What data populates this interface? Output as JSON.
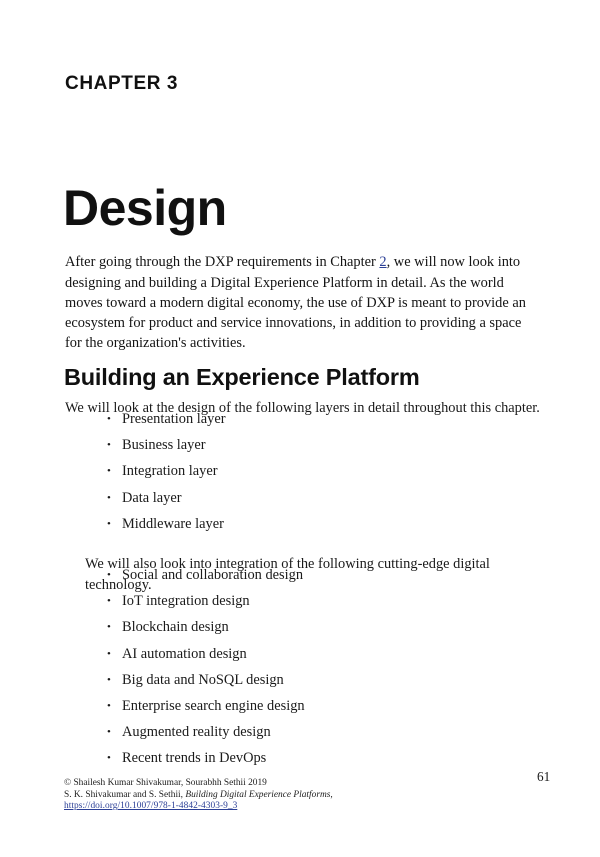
{
  "chapter": {
    "eyebrow": "CHAPTER 3",
    "title": "Design"
  },
  "intro": {
    "before_link": "After going through the DXP requirements in Chapter ",
    "link_text": "2",
    "after_link": ", we will now look into designing and building a Digital Experience Platform in detail. As the world moves toward a modern digital economy, the use of DXP is meant to provide an ecosystem for product and service innovations, in addition to providing a space for the organization's activities."
  },
  "section": {
    "heading": "Building an Experience Platform",
    "lead_in_layers": "We will look at the design of the following layers in detail throughout this chapter.",
    "lead_in_tech": "We will also look into integration of the following cutting-edge digital technology."
  },
  "bullet_glyph": "•",
  "layers_list": [
    {
      "label": "Presentation layer"
    },
    {
      "label": "Business layer"
    },
    {
      "label": "Integration layer"
    },
    {
      "label": "Data layer"
    },
    {
      "label": "Middleware layer"
    }
  ],
  "tech_list": [
    {
      "label": "Social and collaboration design"
    },
    {
      "label": "IoT integration design"
    },
    {
      "label": "Blockchain design"
    },
    {
      "label": "AI automation design"
    },
    {
      "label": "Big data and NoSQL design"
    },
    {
      "label": "Enterprise search engine design"
    },
    {
      "label": "Augmented reality design"
    },
    {
      "label": "Recent trends in DevOps"
    }
  ],
  "footer": {
    "copyright": "© Shailesh Kumar Shivakumar, Sourabhh Sethii 2019",
    "citation_prefix": "S. K. Shivakumar and S. Sethii, ",
    "book_title": "Building Digital Experience Platforms",
    "citation_suffix": ",",
    "doi": "https://doi.org/10.1007/978-1-4842-4303-9_3",
    "page_number": "61"
  },
  "colors": {
    "link": "#2b3f96",
    "text": "#1a1a1a",
    "background": "#ffffff"
  }
}
